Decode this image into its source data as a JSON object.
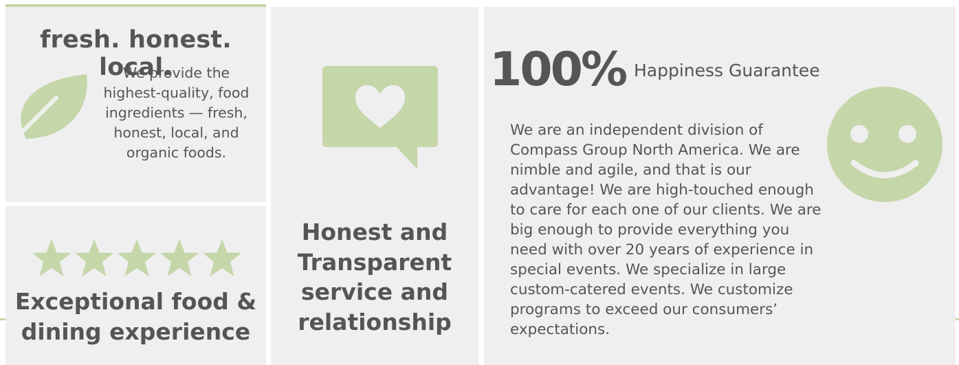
{
  "colors": {
    "panel_bg": "#efefef",
    "accent_green": "#c5d6a9",
    "text": "#555555"
  },
  "fresh": {
    "title": "fresh. honest. local.",
    "icon": "leaf-icon",
    "lines": [
      "We provide the",
      "highest-quality, food",
      "ingredients — fresh,",
      "honest, local, and",
      "organic foods."
    ]
  },
  "experience": {
    "icon": "five-stars-icon",
    "rating": 5,
    "lines": [
      "Exceptional food &",
      "dining experience"
    ]
  },
  "honest": {
    "icon": "heart-speech-bubble-icon",
    "lines": [
      "Honest and",
      "Transparent",
      "service and",
      "relationship"
    ]
  },
  "happiness": {
    "percent": "100%",
    "label": "Happiness Guarantee",
    "icon": "smiley-face-icon",
    "lines": [
      "We are an independent division of",
      "Compass Group North America. We are",
      "nimble and agile, and that is our",
      "advantage! We are high-touched enough",
      "to care for each one of our clients. We are",
      "big enough to provide everything you",
      "need with over 20 years of experience in",
      "special events. We specialize in large",
      "custom-catered events. We customize",
      "programs to exceed our consumers’",
      "expectations."
    ]
  }
}
